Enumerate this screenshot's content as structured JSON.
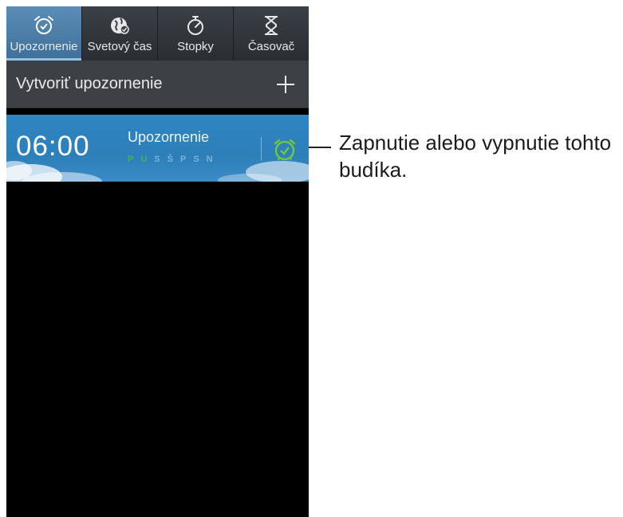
{
  "tabs": [
    {
      "label": "Upozornenie",
      "icon": "alarm-clock-icon",
      "active": true
    },
    {
      "label": "Svetový čas",
      "icon": "globe-icon",
      "active": false
    },
    {
      "label": "Stopky",
      "icon": "stopwatch-icon",
      "active": false
    },
    {
      "label": "Časovač",
      "icon": "hourglass-icon",
      "active": false
    }
  ],
  "create_alarm": {
    "label": "Vytvoriť upozornenie",
    "icon": "plus-icon"
  },
  "alarm": {
    "time": "06:00",
    "name": "Upozornenie",
    "days": [
      "P",
      "U",
      "S",
      "Š",
      "P",
      "S",
      "N"
    ],
    "toggle_icon": "alarm-check-icon",
    "enabled": true
  },
  "callout": {
    "text": "Zapnutie alebo vypnutie tohto budíka."
  },
  "colors": {
    "tab_active": "#4c80ab",
    "alarm_bg": "#2f86c3",
    "toggle_on": "#6cc644"
  }
}
